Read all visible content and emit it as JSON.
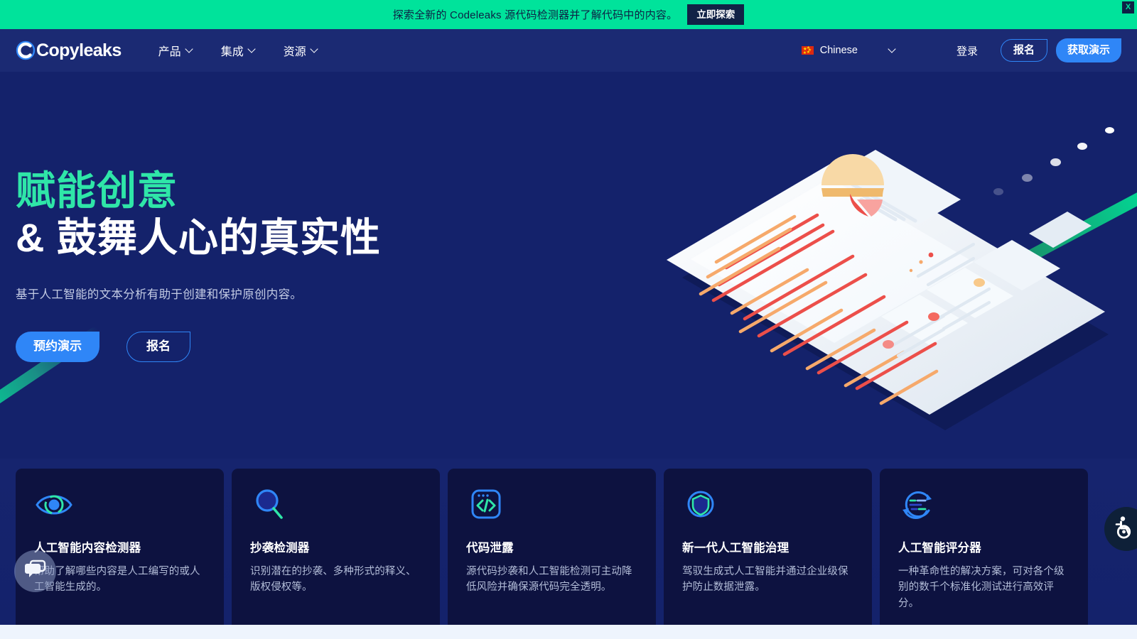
{
  "promo": {
    "text": "探索全新的 Codeleaks 源代码检测器并了解代码中的内容。",
    "button": "立即探索",
    "close": "X"
  },
  "header": {
    "logo_text": "Copyleaks",
    "nav": [
      {
        "label": "产品"
      },
      {
        "label": "集成"
      },
      {
        "label": "资源"
      }
    ],
    "language": "Chinese",
    "login": "登录",
    "signup": "报名",
    "demo": "获取演示"
  },
  "hero": {
    "title_line1": "赋能创意",
    "title_line2": "& 鼓舞人心的真实性",
    "subtitle": "基于人工智能的文本分析有助于创建和保护原创内容。",
    "cta_primary": "预约演示",
    "cta_secondary": "报名"
  },
  "cards": [
    {
      "icon": "eye-icon",
      "title": "人工智能内容检测器",
      "desc": "帮助了解哪些内容是人工编写的或人工智能生成的。"
    },
    {
      "icon": "magnifier-icon",
      "title": "抄袭检测器",
      "desc": "识别潜在的抄袭、多种形式的释义、版权侵权等。"
    },
    {
      "icon": "code-brackets-icon",
      "title": "代码泄露",
      "desc": "源代码抄袭和人工智能检测可主动降低风险并确保源代码完全透明。"
    },
    {
      "icon": "shield-icon",
      "title": "新一代人工智能治理",
      "desc": "驾驭生成式人工智能并通过企业级保护防止数据泄露。"
    },
    {
      "icon": "grading-cycle-icon",
      "title": "人工智能评分器",
      "desc": "一种革命性的解决方案，可对各个级别的数千个标准化测试进行高效评分。"
    }
  ],
  "colors": {
    "banner_green": "#00e39b",
    "hero_navy": "#14226b",
    "header_navy": "#1b2a73",
    "card_navy": "#0d1240",
    "accent_blue": "#2f86f7",
    "accent_green": "#2fe6a8"
  }
}
